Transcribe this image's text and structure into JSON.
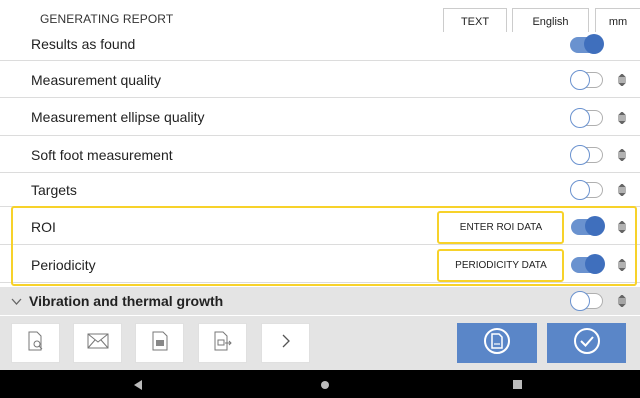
{
  "header": {
    "title": "GENERATING REPORT",
    "text_button": "TEXT",
    "language": "English",
    "unit": "mm"
  },
  "rows": [
    {
      "label": "Results as found",
      "enabled": true
    },
    {
      "label": "Measurement quality",
      "enabled": false
    },
    {
      "label": "Measurement ellipse quality",
      "enabled": false
    },
    {
      "label": "Soft foot measurement",
      "enabled": false
    },
    {
      "label": "Targets",
      "enabled": false
    },
    {
      "label": "ROI",
      "enabled": true,
      "action": "ENTER ROI DATA"
    },
    {
      "label": "Periodicity",
      "enabled": true,
      "action": "PERIODICITY DATA"
    }
  ],
  "group": {
    "label": "Vibration and thermal growth",
    "enabled": false
  },
  "toolbar": {
    "icons": [
      "preview-report-icon",
      "email-icon",
      "document-icon",
      "export-icon",
      "chevron-right-icon"
    ],
    "pdf_icon": "pdf-icon",
    "confirm_icon": "checkmark-icon"
  },
  "colors": {
    "accent": "#5a86c8",
    "highlight": "#f7d22a",
    "toggle_on": "#3f6fbd"
  }
}
